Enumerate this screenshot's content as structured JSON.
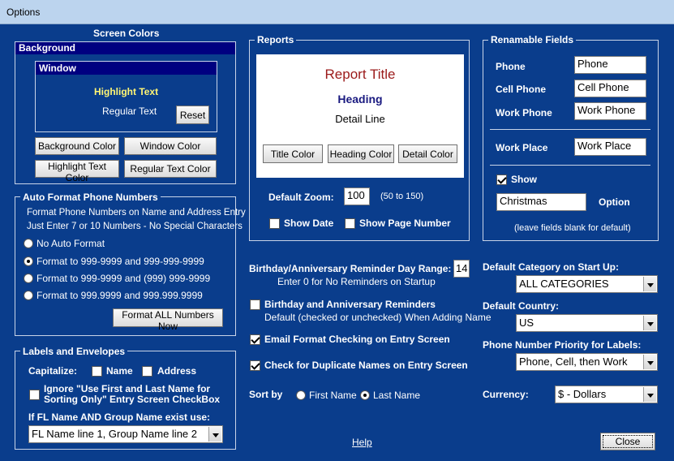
{
  "window": {
    "title": "Options"
  },
  "screen_colors": {
    "title": "Screen Colors",
    "background_label": "Background",
    "window_label": "Window",
    "highlight_text": "Highlight Text",
    "regular_text": "Regular Text",
    "reset": "Reset",
    "background_color": "Background Color",
    "window_color": "Window Color",
    "highlight_text_color": "Highlight Text Color",
    "regular_text_color": "Regular Text Color"
  },
  "phone_format": {
    "title": "Auto Format Phone Numbers",
    "desc1": "Format Phone Numbers on Name and Address Entry",
    "desc2": "Just Enter 7 or 10 Numbers - No Special Characters",
    "options": [
      "No Auto Format",
      "Format to 999-9999 and 999-999-9999",
      "Format to 999-9999 and (999) 999-9999",
      "Format to 999.9999 and 999.999.9999"
    ],
    "selected": 1,
    "format_all": "Format ALL Numbers Now"
  },
  "labels": {
    "title": "Labels and Envelopes",
    "capitalize": "Capitalize:",
    "name": "Name",
    "address": "Address",
    "ignore_line1": "Ignore  \"Use First and Last Name for",
    "ignore_line2": "Sorting Only\"  Entry Screen CheckBox",
    "if_label": "If FL Name AND Group Name exist use:",
    "select_value": "FL Name line 1, Group Name line 2"
  },
  "reports": {
    "title": "Reports",
    "report_title": "Report Title",
    "heading": "Heading",
    "detail_line": "Detail Line",
    "title_color": "Title Color",
    "heading_color": "Heading Color",
    "detail_color": "Detail Color",
    "default_zoom": "Default Zoom:",
    "zoom_value": "100",
    "zoom_range": "(50 to 150)",
    "show_date": "Show Date",
    "show_page_number": "Show Page Number"
  },
  "reminders": {
    "range_label": "Birthday/Anniversary Reminder Day Range:",
    "range_value": "14",
    "range_note": "Enter 0 for No Reminders on Startup",
    "bday_label": "Birthday and Anniversary Reminders",
    "bday_note": "Default (checked or unchecked) When Adding Name",
    "email_check": "Email Format Checking on Entry Screen",
    "dup_check": "Check for Duplicate Names on Entry Screen",
    "sort_by": "Sort by",
    "first_name": "First Name",
    "last_name": "Last Name"
  },
  "renamable": {
    "title": "Renamable Fields",
    "phone_label": "Phone",
    "phone_value": "Phone",
    "cell_label": "Cell Phone",
    "cell_value": "Cell Phone",
    "work_label": "Work Phone",
    "work_value": "Work Phone",
    "workplace_label": "Work Place",
    "workplace_value": "Work Place",
    "show": "Show",
    "option_value": "Christmas",
    "option_label": "Option",
    "note": "(leave fields blank for default)"
  },
  "defaults": {
    "category_label": "Default Category on Start Up:",
    "category_value": "ALL CATEGORIES",
    "country_label": "Default Country:",
    "country_value": "US",
    "priority_label": "Phone Number Priority for Labels:",
    "priority_value": "Phone, Cell, then Work",
    "currency_label": "Currency:",
    "currency_value": "$ - Dollars"
  },
  "footer": {
    "help": "Help",
    "close": "Close"
  }
}
